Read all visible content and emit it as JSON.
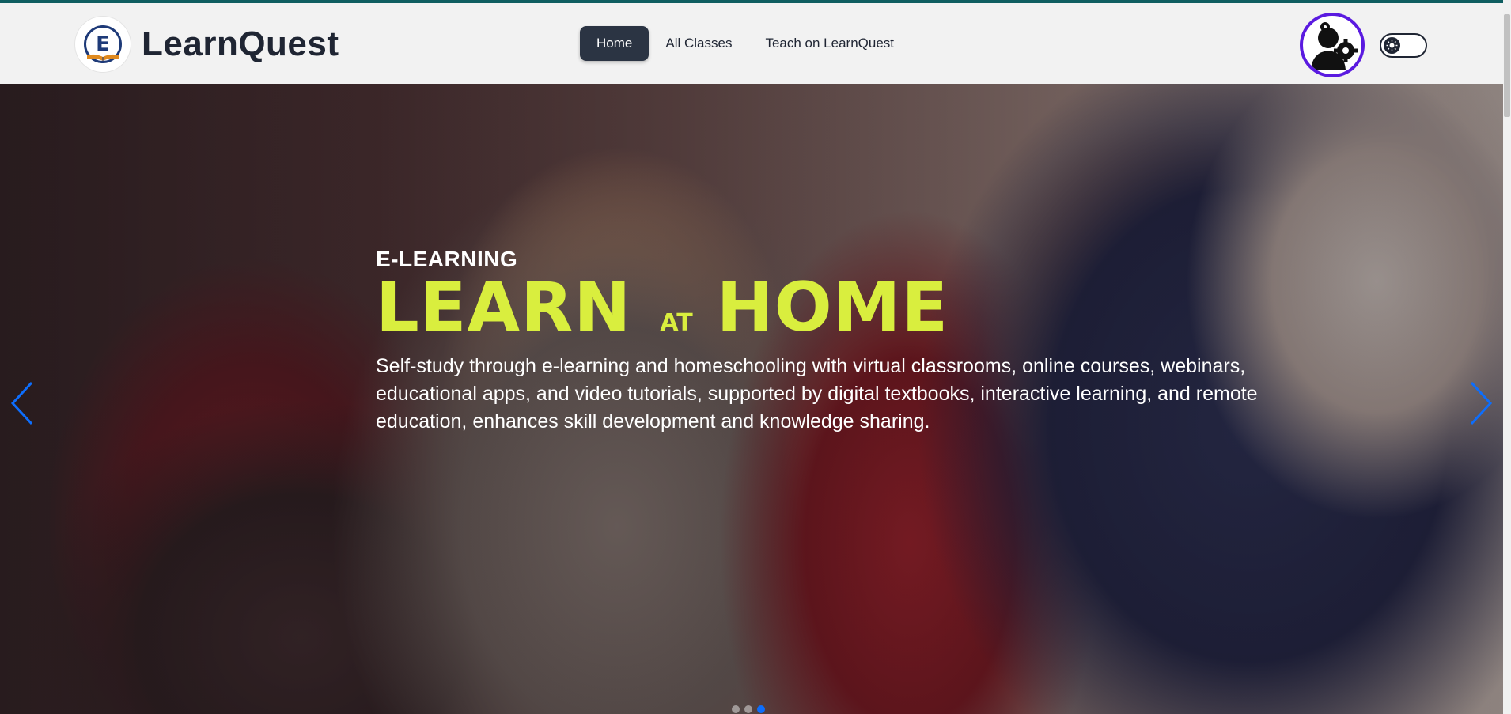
{
  "brand": {
    "name": "LearnQuest",
    "logo_letter": "E"
  },
  "nav": {
    "items": [
      {
        "label": "Home",
        "active": true
      },
      {
        "label": "All Classes",
        "active": false
      },
      {
        "label": "Teach on LearnQuest",
        "active": false
      }
    ]
  },
  "hero": {
    "eyebrow": "E-LEARNING",
    "title_part1": "LEARN",
    "title_part2": "AT",
    "title_part3": "HOME",
    "description": "Self-study through e-learning and homeschooling with virtual classrooms, online courses, webinars, educational apps, and video tutorials, supported by digital textbooks, interactive learning, and remote education, enhances skill development and knowledge sharing.",
    "carousel": {
      "slide_count": 3,
      "active_index": 2
    }
  },
  "icons": {
    "logo": "book-logo-icon",
    "avatar": "user-gear-icon",
    "theme_toggle": "sun-icon",
    "prev": "chevron-left-icon",
    "next": "chevron-right-icon"
  },
  "colors": {
    "accent_top": "#0f5e61",
    "nav_active_bg": "#2b3443",
    "hero_title": "#d9ee3e",
    "avatar_ring": "#5a1ae0",
    "carousel_arrow": "#0d6efd"
  }
}
